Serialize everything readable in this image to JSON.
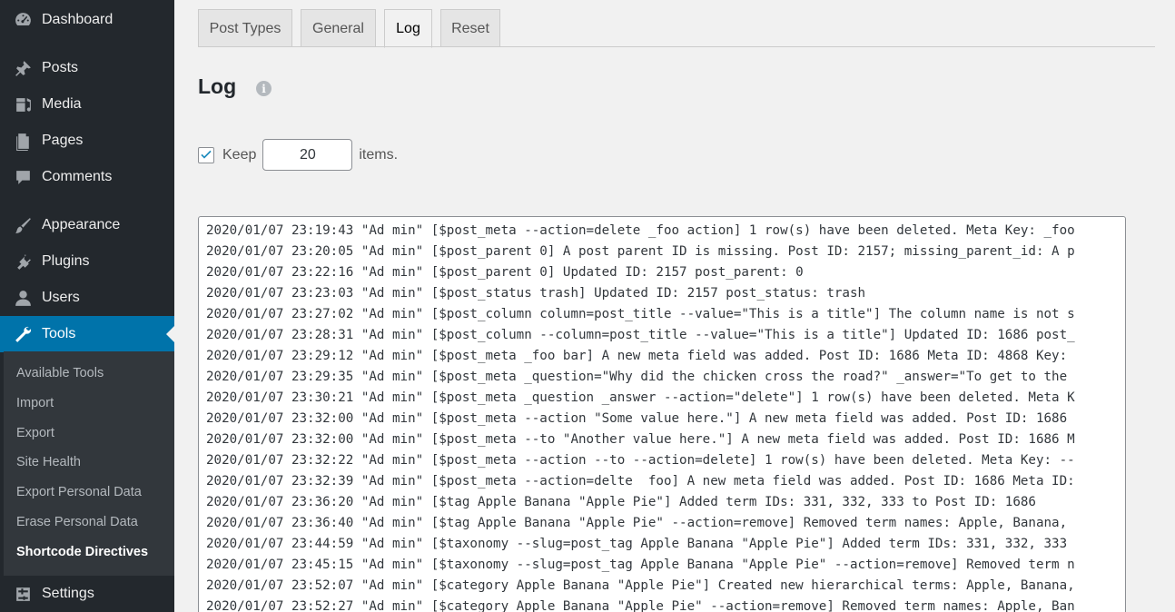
{
  "sidebar": {
    "items": [
      {
        "label": "Dashboard",
        "icon": "dashboard-icon"
      },
      {
        "label": "Posts",
        "icon": "pin-icon"
      },
      {
        "label": "Media",
        "icon": "media-icon"
      },
      {
        "label": "Pages",
        "icon": "pages-icon"
      },
      {
        "label": "Comments",
        "icon": "comment-icon"
      },
      {
        "label": "Appearance",
        "icon": "brush-icon"
      },
      {
        "label": "Plugins",
        "icon": "plugin-icon"
      },
      {
        "label": "Users",
        "icon": "user-icon"
      },
      {
        "label": "Tools",
        "icon": "wrench-icon"
      },
      {
        "label": "Settings",
        "icon": "settings-icon"
      }
    ],
    "submenu": [
      "Available Tools",
      "Import",
      "Export",
      "Site Health",
      "Export Personal Data",
      "Erase Personal Data",
      "Shortcode Directives"
    ]
  },
  "tabs": [
    "Post Types",
    "General",
    "Log",
    "Reset"
  ],
  "page": {
    "title": "Log",
    "help_icon": "i",
    "keep_label": "Keep",
    "keep_value": "20",
    "items_label": "items."
  },
  "log": [
    "2020/01/07 23:19:43 \"Ad min\" [$post_meta --action=delete _foo action] 1 row(s) have been deleted. Meta Key: _foo",
    "2020/01/07 23:20:05 \"Ad min\" [$post_parent 0] A post parent ID is missing. Post ID: 2157; missing_parent_id: A p",
    "2020/01/07 23:22:16 \"Ad min\" [$post_parent 0] Updated ID: 2157 post_parent: 0",
    "2020/01/07 23:23:03 \"Ad min\" [$post_status trash] Updated ID: 2157 post_status: trash",
    "2020/01/07 23:27:02 \"Ad min\" [$post_column column=post_title --value=\"This is a title\"] The column name is not s",
    "2020/01/07 23:28:31 \"Ad min\" [$post_column --column=post_title --value=\"This is a title\"] Updated ID: 1686 post_",
    "2020/01/07 23:29:12 \"Ad min\" [$post_meta _foo bar] A new meta field was added. Post ID: 1686 Meta ID: 4868 Key:",
    "2020/01/07 23:29:35 \"Ad min\" [$post_meta _question=\"Why did the chicken cross the road?\" _answer=\"To get to the",
    "2020/01/07 23:30:21 \"Ad min\" [$post_meta _question _answer --action=\"delete\"] 1 row(s) have been deleted. Meta K",
    "2020/01/07 23:32:00 \"Ad min\" [$post_meta --action \"Some value here.\"] A new meta field was added. Post ID: 1686",
    "2020/01/07 23:32:00 \"Ad min\" [$post_meta --to \"Another value here.\"] A new meta field was added. Post ID: 1686 M",
    "2020/01/07 23:32:22 \"Ad min\" [$post_meta --action --to --action=delete] 1 row(s) have been deleted. Meta Key: --",
    "2020/01/07 23:32:39 \"Ad min\" [$post_meta --action=delte  foo] A new meta field was added. Post ID: 1686 Meta ID:",
    "2020/01/07 23:36:20 \"Ad min\" [$tag Apple Banana \"Apple Pie\"] Added term IDs: 331, 332, 333 to Post ID: 1686",
    "2020/01/07 23:36:40 \"Ad min\" [$tag Apple Banana \"Apple Pie\" --action=remove] Removed term names: Apple, Banana,",
    "2020/01/07 23:44:59 \"Ad min\" [$taxonomy --slug=post_tag Apple Banana \"Apple Pie\"] Added term IDs: 331, 332, 333",
    "2020/01/07 23:45:15 \"Ad min\" [$taxonomy --slug=post_tag Apple Banana \"Apple Pie\" --action=remove] Removed term n",
    "2020/01/07 23:52:07 \"Ad min\" [$category Apple Banana \"Apple Pie\"] Created new hierarchical terms: Apple, Banana,",
    "2020/01/07 23:52:27 \"Ad min\" [$category Apple Banana \"Apple Pie\" --action=remove] Removed term names: Apple, Ban"
  ]
}
